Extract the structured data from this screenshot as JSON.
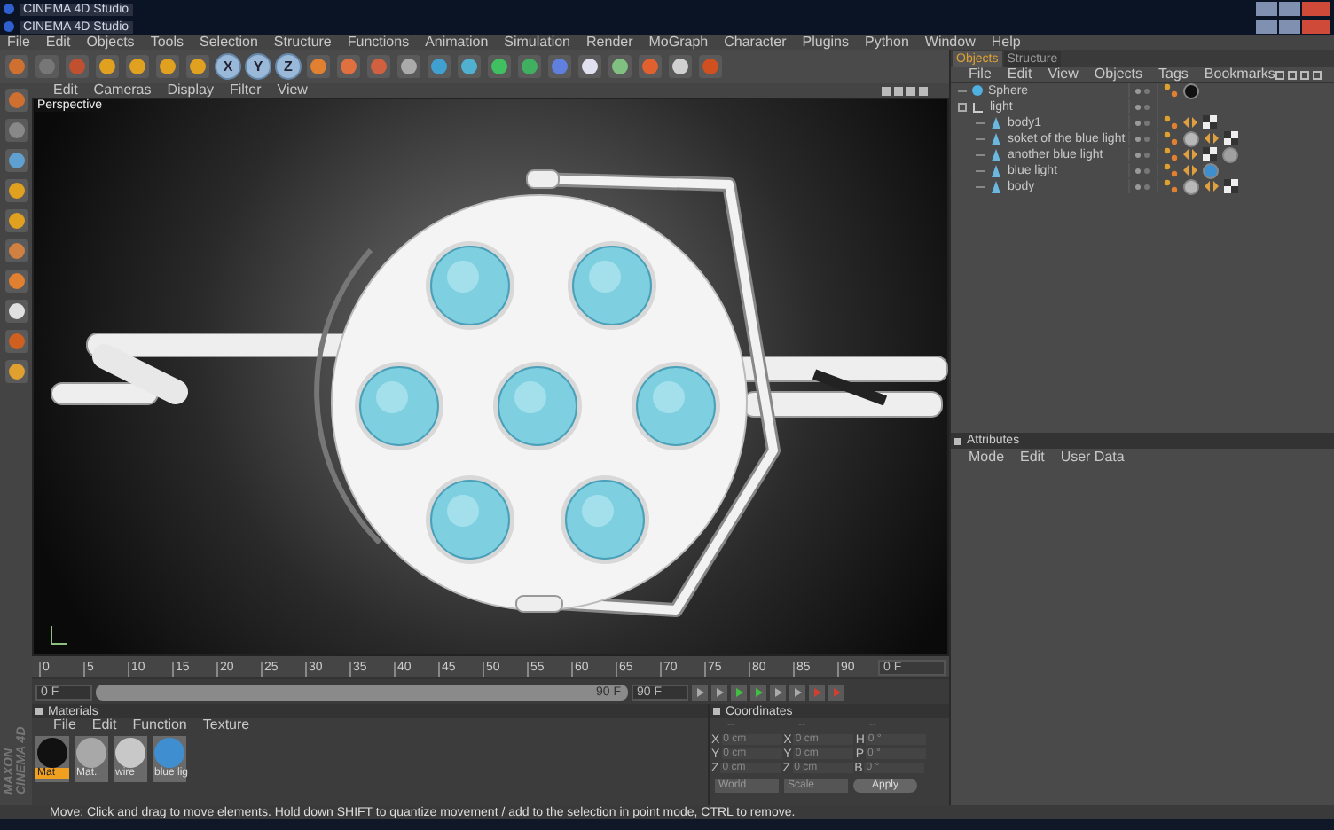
{
  "window": {
    "titles": [
      "CINEMA 4D Studio",
      "CINEMA 4D Studio"
    ]
  },
  "menu": [
    "File",
    "Edit",
    "Objects",
    "Tools",
    "Selection",
    "Structure",
    "Functions",
    "Animation",
    "Simulation",
    "Render",
    "MoGraph",
    "Character",
    "Plugins",
    "Python",
    "Window",
    "Help"
  ],
  "toolbar": {
    "axis_buttons": [
      {
        "label": "X",
        "on": true
      },
      {
        "label": "Y",
        "on": true
      },
      {
        "label": "Z",
        "on": true
      }
    ]
  },
  "viewport": {
    "menu": [
      "Edit",
      "Cameras",
      "Display",
      "Filter",
      "View"
    ],
    "camera_label": "Perspective"
  },
  "objects_panel": {
    "tabs": [
      {
        "label": "Objects",
        "selected": true
      },
      {
        "label": "Structure",
        "selected": false
      }
    ],
    "menu": [
      "File",
      "Edit",
      "View",
      "Objects",
      "Tags",
      "Bookmarks"
    ],
    "tree": [
      {
        "name": "Sphere",
        "kind": "sphere",
        "tags": [
          {
            "kind": "phong"
          },
          {
            "kind": "material",
            "color": "#111111"
          }
        ]
      },
      {
        "name": "light",
        "kind": "null",
        "children": [
          {
            "name": "body1",
            "kind": "polygon",
            "tags": [
              {
                "kind": "phong"
              },
              {
                "kind": "compositing"
              },
              {
                "kind": "texture"
              }
            ]
          },
          {
            "name": "soket of the blue light",
            "kind": "polygon",
            "tags": [
              {
                "kind": "phong"
              },
              {
                "kind": "material",
                "color": "#b8b8b8"
              },
              {
                "kind": "compositing"
              },
              {
                "kind": "texture"
              }
            ]
          },
          {
            "name": "another blue light",
            "kind": "polygon",
            "tags": [
              {
                "kind": "phong"
              },
              {
                "kind": "compositing"
              },
              {
                "kind": "texture"
              },
              {
                "kind": "material",
                "color": "#a0a0a0"
              }
            ]
          },
          {
            "name": "blue light",
            "kind": "polygon",
            "tags": [
              {
                "kind": "phong"
              },
              {
                "kind": "compositing"
              },
              {
                "kind": "material",
                "color": "#3f8fd0"
              }
            ]
          },
          {
            "name": "body",
            "kind": "polygon",
            "tags": [
              {
                "kind": "phong"
              },
              {
                "kind": "material",
                "color": "#b8b8b8"
              },
              {
                "kind": "compositing"
              },
              {
                "kind": "texture"
              }
            ]
          }
        ]
      }
    ]
  },
  "attributes_panel": {
    "title": "Attributes",
    "menu": [
      "Mode",
      "Edit",
      "User Data"
    ]
  },
  "timeline": {
    "ticks": [
      "0",
      "5",
      "10",
      "15",
      "20",
      "25",
      "30",
      "35",
      "40",
      "45",
      "50",
      "55",
      "60",
      "65",
      "70",
      "75",
      "80",
      "85",
      "90"
    ],
    "current_frame": "0 F",
    "start_field": "0 F",
    "range": {
      "level": 1
    },
    "range_end": "90 F",
    "end_field": "90 F"
  },
  "materials_panel": {
    "title": "Materials",
    "menu": [
      "File",
      "Edit",
      "Function",
      "Texture"
    ],
    "materials": [
      {
        "name": "Mat",
        "color": "#111111",
        "selected": true
      },
      {
        "name": "Mat.",
        "color": "#a8a8a8",
        "selected": false
      },
      {
        "name": "wire",
        "color": "#c8c8c8",
        "selected": false
      },
      {
        "name": "blue lig",
        "color": "#3f8fd0",
        "selected": false
      }
    ]
  },
  "coordinates_panel": {
    "title": "Coordinates",
    "header": [
      "--",
      "--",
      "--"
    ],
    "rows": [
      {
        "axis": "X",
        "position": "0 cm",
        "size_axis": "X",
        "size": "0 cm",
        "rot_axis": "H",
        "rotation": "0 °"
      },
      {
        "axis": "Y",
        "position": "0 cm",
        "size_axis": "Y",
        "size": "0 cm",
        "rot_axis": "P",
        "rotation": "0 °"
      },
      {
        "axis": "Z",
        "position": "0 cm",
        "size_axis": "Z",
        "size": "0 cm",
        "rot_axis": "B",
        "rotation": "0 °"
      }
    ],
    "dropdowns": [
      "World",
      "Scale"
    ],
    "apply": "Apply"
  },
  "status_bar": "Move: Click and drag to move elements. Hold down SHIFT to quantize movement / add to the selection in point mode, CTRL to remove.",
  "logo": [
    "MAXON",
    "CINEMA 4D"
  ]
}
